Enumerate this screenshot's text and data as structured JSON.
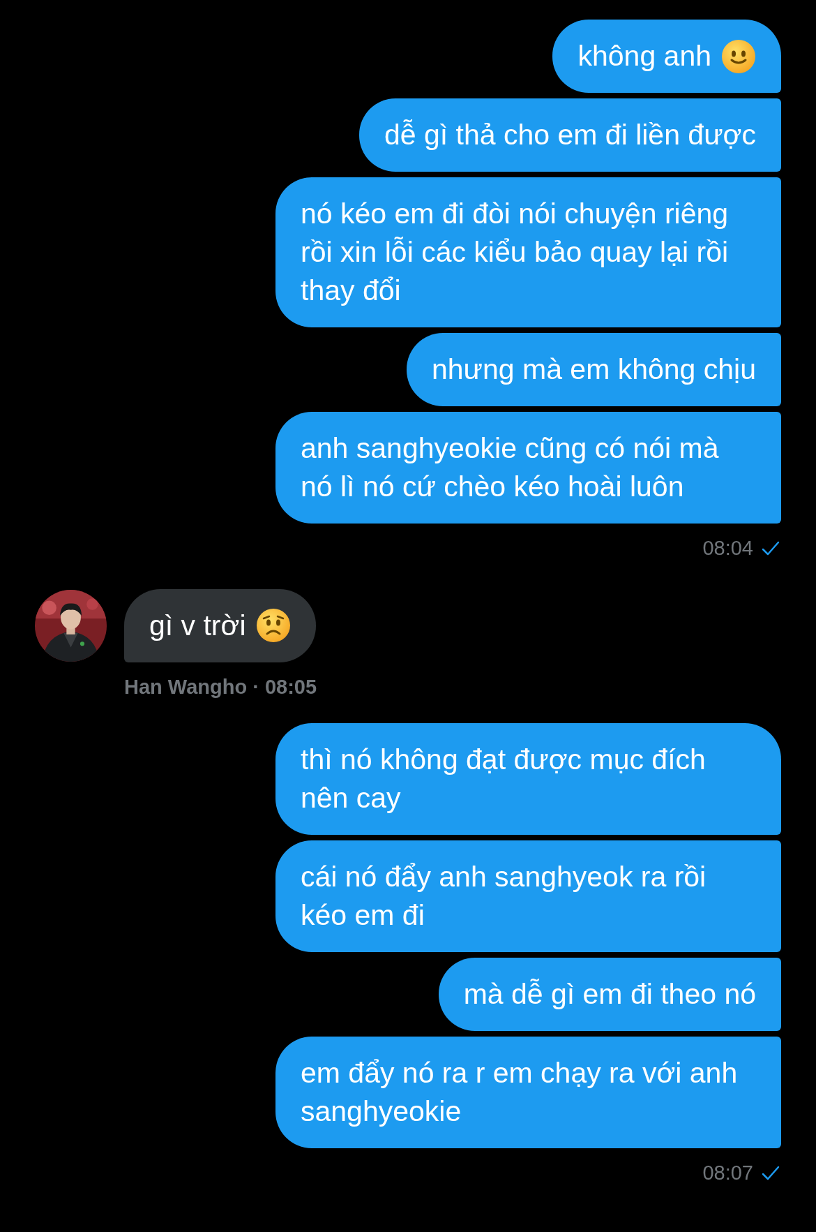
{
  "groups": [
    {
      "outgoing": true,
      "messages": [
        {
          "text": "không anh",
          "kind": "smile"
        },
        {
          "text": "dễ gì thả cho em đi liền được",
          "kind": "plain"
        },
        {
          "text": "nó kéo em đi đòi nói chuyện riêng rồi xin lỗi các kiểu bảo quay lại rồi thay đổi",
          "kind": "plain"
        },
        {
          "text": "nhưng mà em không chịu",
          "kind": "plain"
        },
        {
          "text": "anh sanghyeokie cũng có nói mà nó lì nó cứ chèo kéo hoài luôn",
          "kind": "plain"
        }
      ],
      "time": "08:04",
      "read": true
    },
    {
      "outgoing": false,
      "messages": [
        {
          "text": "gì v trời",
          "kind": "worried"
        }
      ],
      "meta": "Han Wangho · 08:05"
    },
    {
      "outgoing": true,
      "messages": [
        {
          "text": "thì nó không đạt được mục đích nên cay",
          "kind": "plain"
        },
        {
          "text": "cái nó đẩy anh sanghyeok ra rồi kéo em đi",
          "kind": "plain"
        },
        {
          "text": "mà dễ gì em đi theo nó",
          "kind": "plain"
        },
        {
          "text": "em đẩy nó ra r em chạy ra với anh sanghyeokie",
          "kind": "plain"
        }
      ],
      "time": "08:07",
      "read": true
    }
  ]
}
